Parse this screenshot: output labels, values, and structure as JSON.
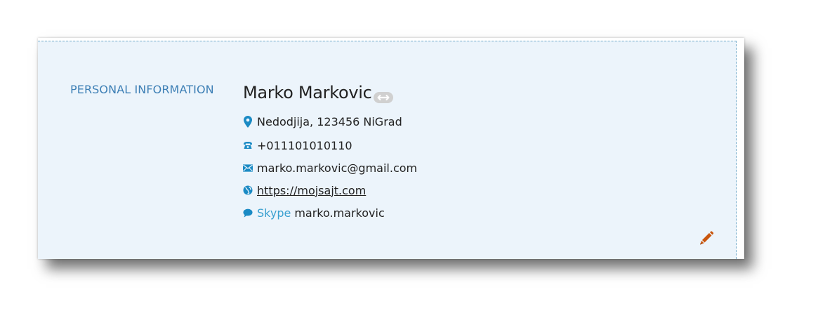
{
  "section": {
    "label": "PERSONAL INFORMATION"
  },
  "person": {
    "name": "Marko Markovic",
    "address": "Nedodjija, 123456 NiGrad",
    "phone": "+011101010110",
    "email": "marko.markovic@gmail.com",
    "website": "https://mojsajt.com",
    "im_label": "Skype",
    "im_handle": "marko.markovic"
  },
  "icons": {
    "link_badge": "link-icon",
    "address": "map-marker-icon",
    "phone": "phone-icon",
    "email": "envelope-icon",
    "website": "globe-icon",
    "im": "chat-bubble-icon",
    "edit": "pencil-icon"
  },
  "colors": {
    "panel_bg": "#ecf4fb",
    "accent": "#3d7fb5",
    "icon_blue": "#1a8ac4",
    "edit_orange": "#c9560e"
  }
}
